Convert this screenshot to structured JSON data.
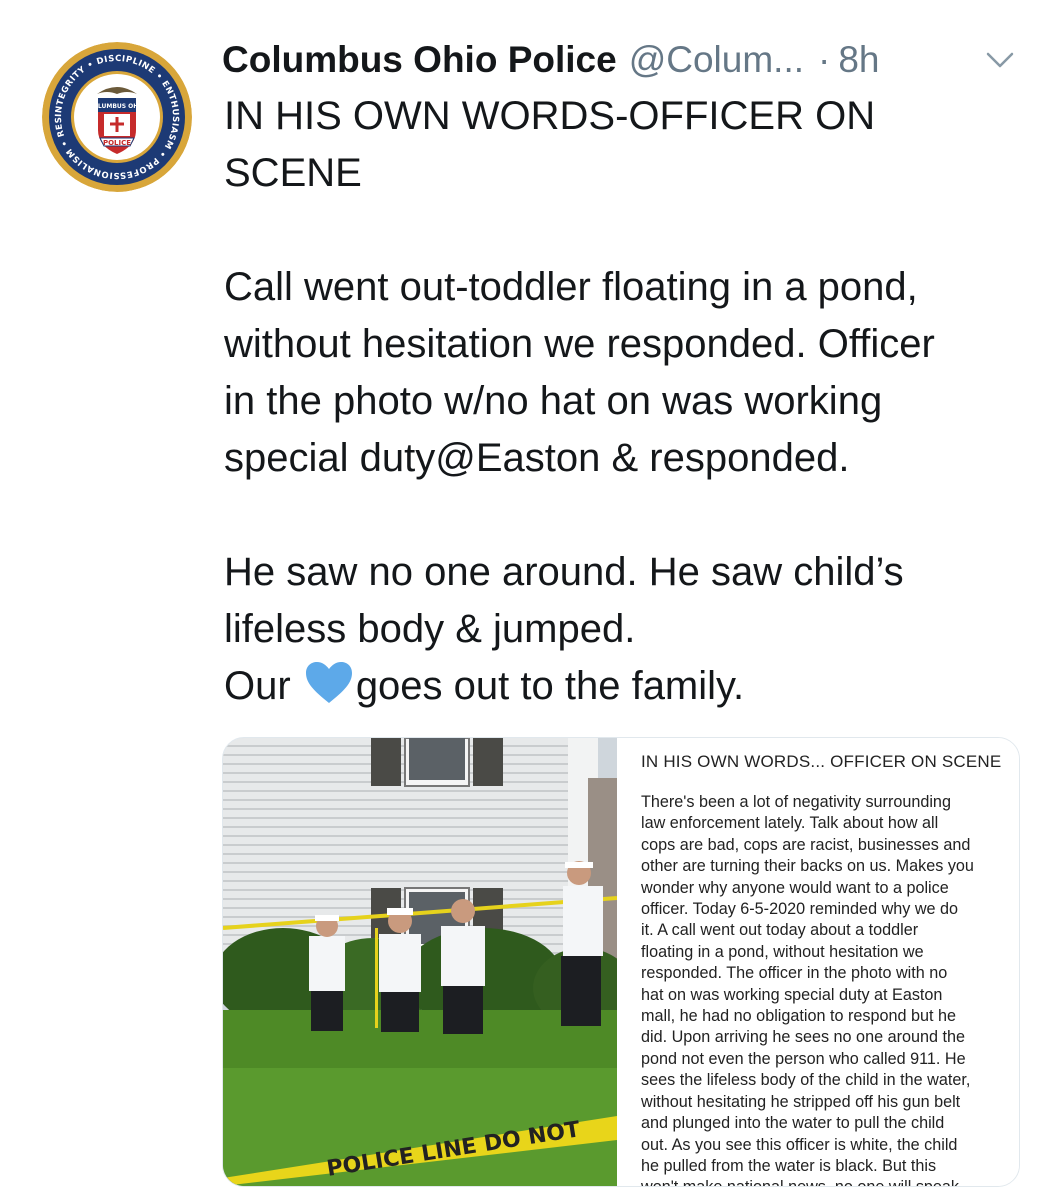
{
  "author": {
    "display_name": "Columbus Ohio Police",
    "handle": "@Colum...",
    "time": "8h",
    "separator": "·",
    "avatar_ring_text": "INTEGRITY • DISCIPLINE • ENTHUSIASM • PROFESSIONALISM • RESPECT",
    "avatar_banner_text": "COLUMBUS OHIO",
    "avatar_ribbon_text": "POLICE"
  },
  "tweet": {
    "lines": [
      "IN HIS OWN WORDS-OFFICER ON",
      "SCENE",
      "",
      "Call went out-toddler floating in a pond,",
      "without hesitation we responded. Officer",
      "in the photo w/no hat on was working",
      "special duty@Easton & responded.",
      "",
      "He saw no one around. He saw child’s",
      "lifeless body & jumped."
    ],
    "last_line_before": "Our",
    "last_line_after": "goes out to the family.",
    "heart_icon": "blue-heart-icon",
    "heart_color": "#5da9e9"
  },
  "media": {
    "tape_text": "POLICE LINE DO NOT",
    "note_title": "IN HIS OWN WORDS... OFFICER ON SCENE",
    "note_lines": [
      "There's been a lot of negativity surrounding",
      "law enforcement lately. Talk about how all",
      "cops are bad, cops are racist, businesses and",
      "other are turning their backs on us. Makes you",
      "wonder why anyone would want to a police",
      "officer. Today 6-5-2020 reminded why we do",
      "it. A call went out today about a toddler",
      "floating in a pond, without hesitation we",
      "responded. The officer in the photo with no",
      "hat on was working special duty at Easton",
      "mall, he had no obligation to respond but he",
      "did. Upon arriving he sees no one around the",
      "pond not even the person who called 911. He",
      "sees the lifeless body of the child in the water,",
      "without hesitating he stripped off his gun belt",
      "and plunged into the water to pull the child",
      "out. As you see this officer is white, the child",
      "he pulled from the water is black. But this",
      "won't make national news, no one will speak"
    ]
  },
  "colors": {
    "name": "#14171a",
    "secondary": "#657786",
    "badge_navy": "#1d3a75",
    "badge_gold": "#d8a63a"
  }
}
